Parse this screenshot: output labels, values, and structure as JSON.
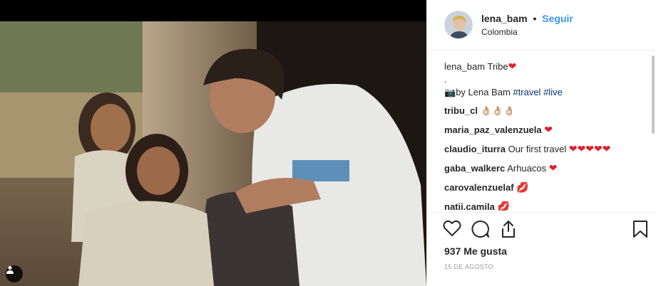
{
  "post": {
    "username": "lena_bam",
    "separator": "•",
    "follow_label": "Seguir",
    "location": "Colombia",
    "likes": "937 Me gusta",
    "date": "15 DE AGOSTO"
  },
  "caption": {
    "user": "lena_bam",
    "text": "Tribe",
    "dot_line": ".",
    "credit": "by Lena Bam",
    "tag1": "#travel",
    "tag2": "#live"
  },
  "comments": [
    {
      "user": "tribu_cl",
      "text": "👌🏼👌🏼👌🏼"
    },
    {
      "user": "maria_paz_valenzuela",
      "text": ""
    },
    {
      "user": "claudio_iturra",
      "text": "Our first travel"
    },
    {
      "user": "gaba_walkerc",
      "text": "Arhuacos"
    },
    {
      "user": "carovalenzuelaf",
      "text": ""
    },
    {
      "user": "natii.camila",
      "text": ""
    }
  ],
  "colors": {
    "link": "#3897f0",
    "hashtag": "#003569",
    "heart": "#e0202f"
  },
  "icons": {
    "like": "heart-outline-icon",
    "comment": "comment-bubble-icon",
    "share": "share-icon",
    "save": "bookmark-icon",
    "tag": "person-tag-icon"
  }
}
